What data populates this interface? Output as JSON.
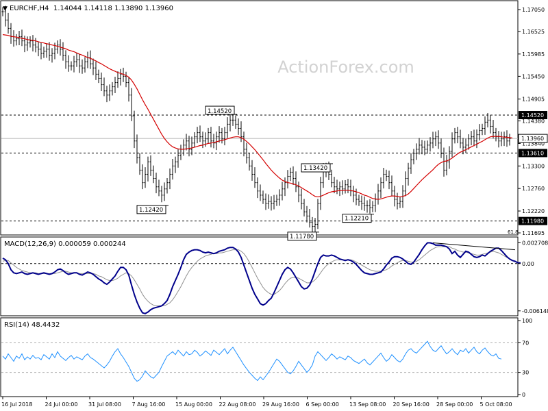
{
  "chart_data": {
    "type": "line",
    "symbol": "EURCHF,H4",
    "ohlc_text": "1.14044 1.14118 1.13890 1.13960",
    "watermark": "ActionForex.com",
    "x_tick_labels": [
      "16 Jul 2018",
      "24 Jul 00:00",
      "31 Jul 08:00",
      "7 Aug 16:00",
      "15 Aug 00:00",
      "22 Aug 08:00",
      "29 Aug 16:00",
      "6 Sep 00:00",
      "13 Sep 08:00",
      "20 Sep 16:00",
      "28 Sep 00:00",
      "5 Oct 08:00"
    ],
    "price_panel": {
      "ylim": [
        1.11695,
        1.1705
      ],
      "y_tick_labels": [
        "1.17050",
        "1.16525",
        "1.15985",
        "1.15450",
        "1.14905",
        "1.14380",
        "1.13840",
        "1.13300",
        "1.12760",
        "1.12220",
        "1.11695"
      ],
      "current_price": "1.13960",
      "levels": [
        {
          "value": 1.1452,
          "label": "1.14520",
          "style": "dashed"
        },
        {
          "value": 1.1361,
          "label": "1.13610",
          "style": "dashed"
        },
        {
          "value": 1.1198,
          "label": "1.11980",
          "style": "dashed"
        }
      ],
      "annotations": [
        {
          "label": "1.14520",
          "bar": 85
        },
        {
          "label": "1.12420",
          "bar": 60
        },
        {
          "label": "1.11780",
          "bar": 115
        },
        {
          "label": "1.13420",
          "bar": 120
        },
        {
          "label": "1.12210",
          "bar": 135
        }
      ],
      "partial_label": "61.8",
      "close": [
        1.17,
        1.168,
        1.166,
        1.164,
        1.163,
        1.1635,
        1.164,
        1.163,
        1.162,
        1.1625,
        1.163,
        1.162,
        1.1615,
        1.161,
        1.16,
        1.1605,
        1.161,
        1.1595,
        1.16,
        1.161,
        1.162,
        1.161,
        1.1595,
        1.158,
        1.157,
        1.157,
        1.158,
        1.1585,
        1.157,
        1.1565,
        1.158,
        1.159,
        1.1575,
        1.1565,
        1.155,
        1.154,
        1.1525,
        1.151,
        1.15,
        1.151,
        1.152,
        1.153,
        1.154,
        1.155,
        1.1545,
        1.153,
        1.15,
        1.145,
        1.139,
        1.135,
        1.132,
        1.129,
        1.131,
        1.134,
        1.132,
        1.13,
        1.128,
        1.127,
        1.126,
        1.1275,
        1.129,
        1.131,
        1.133,
        1.134,
        1.1355,
        1.137,
        1.138,
        1.139,
        1.137,
        1.1385,
        1.14,
        1.141,
        1.14,
        1.139,
        1.1395,
        1.141,
        1.139,
        1.1385,
        1.14,
        1.141,
        1.1395,
        1.141,
        1.143,
        1.144,
        1.144,
        1.143,
        1.142,
        1.14,
        1.137,
        1.135,
        1.133,
        1.131,
        1.129,
        1.127,
        1.126,
        1.125,
        1.124,
        1.1245,
        1.124,
        1.1245,
        1.125,
        1.126,
        1.1275,
        1.129,
        1.1305,
        1.1315,
        1.13,
        1.128,
        1.126,
        1.124,
        1.122,
        1.121,
        1.1195,
        1.1185,
        1.119,
        1.124,
        1.129,
        1.132,
        1.1325,
        1.131,
        1.129,
        1.128,
        1.1275,
        1.128,
        1.1275,
        1.1285,
        1.128,
        1.127,
        1.126,
        1.125,
        1.1245,
        1.124,
        1.1235,
        1.1235,
        1.123,
        1.1235,
        1.125,
        1.127,
        1.129,
        1.131,
        1.1305,
        1.129,
        1.127,
        1.125,
        1.124,
        1.1245,
        1.127,
        1.13,
        1.1325,
        1.1345,
        1.136,
        1.137,
        1.138,
        1.1375,
        1.137,
        1.138,
        1.1385,
        1.1395,
        1.14,
        1.1385,
        1.136,
        1.132,
        1.134,
        1.1365,
        1.1395,
        1.141,
        1.14,
        1.1385,
        1.1375,
        1.138,
        1.1395,
        1.14,
        1.139,
        1.1405,
        1.1415,
        1.142,
        1.1435,
        1.144,
        1.1425,
        1.141,
        1.14,
        1.139,
        1.1395,
        1.14,
        1.139,
        1.1396
      ],
      "ma_line": [
        1.1645,
        1.1644,
        1.1643,
        1.1641,
        1.164,
        1.1639,
        1.1638,
        1.1636,
        1.1635,
        1.1633,
        1.1632,
        1.1631,
        1.163,
        1.1628,
        1.1626,
        1.1625,
        1.1623,
        1.1622,
        1.162,
        1.1619,
        1.1617,
        1.1615,
        1.1613,
        1.1611,
        1.1608,
        1.1606,
        1.1604,
        1.1601,
        1.1598,
        1.1596,
        1.1593,
        1.159,
        1.1588,
        1.1585,
        1.1582,
        1.1578,
        1.1575,
        1.1571,
        1.1567,
        1.1563,
        1.156,
        1.1557,
        1.1554,
        1.1552,
        1.155,
        1.1547,
        1.1543,
        1.1536,
        1.1526,
        1.1515,
        1.1502,
        1.1489,
        1.1477,
        1.1466,
        1.1454,
        1.1442,
        1.143,
        1.1418,
        1.1406,
        1.1396,
        1.1388,
        1.1381,
        1.1376,
        1.1373,
        1.1371,
        1.137,
        1.137,
        1.1371,
        1.1372,
        1.1373,
        1.1375,
        1.1377,
        1.1379,
        1.138,
        1.1382,
        1.1384,
        1.1385,
        1.1386,
        1.1388,
        1.139,
        1.1391,
        1.1393,
        1.1395,
        1.1397,
        1.1399,
        1.14,
        1.14,
        1.1398,
        1.1394,
        1.1389,
        1.1383,
        1.1376,
        1.1369,
        1.1361,
        1.1353,
        1.1345,
        1.1336,
        1.1328,
        1.132,
        1.1313,
        1.1307,
        1.1301,
        1.1296,
        1.1293,
        1.129,
        1.1289,
        1.1287,
        1.1285,
        1.1282,
        1.1278,
        1.1274,
        1.127,
        1.1266,
        1.1261,
        1.1257,
        1.1256,
        1.1257,
        1.126,
        1.1263,
        1.1266,
        1.1268,
        1.1269,
        1.127,
        1.1271,
        1.1271,
        1.1272,
        1.1272,
        1.1271,
        1.127,
        1.1268,
        1.1266,
        1.1263,
        1.126,
        1.1258,
        1.1255,
        1.1252,
        1.1251,
        1.125,
        1.1251,
        1.1253,
        1.1255,
        1.1257,
        1.1258,
        1.1258,
        1.1257,
        1.1256,
        1.1257,
        1.1259,
        1.1263,
        1.1269,
        1.1276,
        1.1283,
        1.129,
        1.1297,
        1.1303,
        1.1309,
        1.1315,
        1.1321,
        1.1328,
        1.1334,
        1.1338,
        1.1341,
        1.1342,
        1.1345,
        1.1349,
        1.1354,
        1.1359,
        1.1363,
        1.1366,
        1.1369,
        1.1372,
        1.1376,
        1.1379,
        1.1382,
        1.1386,
        1.1389,
        1.1393,
        1.1397,
        1.14,
        1.1401,
        1.1401,
        1.1401,
        1.14,
        1.1399,
        1.1399,
        1.1398,
        1.1397
      ]
    },
    "macd_panel": {
      "title": "MACD(12,26,9) 0.000059 0.000244",
      "y_tick_labels": [
        "0.002708",
        "0.00",
        "-0.006148"
      ],
      "ylim": [
        -0.0067,
        0.0031
      ],
      "macd_line": [
        0.0007,
        0.0005,
        0.0,
        -0.0008,
        -0.0012,
        -0.0013,
        -0.0012,
        -0.0011,
        -0.0013,
        -0.0014,
        -0.0013,
        -0.0012,
        -0.0013,
        -0.0014,
        -0.0013,
        -0.0012,
        -0.0013,
        -0.0014,
        -0.0013,
        -0.0011,
        -0.0008,
        -0.0007,
        -0.0009,
        -0.0012,
        -0.0014,
        -0.0013,
        -0.0012,
        -0.0012,
        -0.0014,
        -0.0015,
        -0.0013,
        -0.0011,
        -0.0012,
        -0.0014,
        -0.0017,
        -0.002,
        -0.0022,
        -0.0025,
        -0.0027,
        -0.0024,
        -0.002,
        -0.0016,
        -0.001,
        -0.0005,
        -0.0005,
        -0.0008,
        -0.0015,
        -0.0028,
        -0.004,
        -0.005,
        -0.0058,
        -0.0064,
        -0.0065,
        -0.0063,
        -0.006,
        -0.0058,
        -0.0057,
        -0.0056,
        -0.0055,
        -0.0052,
        -0.0048,
        -0.004,
        -0.003,
        -0.0022,
        -0.0014,
        -0.0005,
        0.0005,
        0.0012,
        0.0015,
        0.0017,
        0.0018,
        0.0018,
        0.0017,
        0.0015,
        0.0014,
        0.0015,
        0.0014,
        0.0013,
        0.0014,
        0.0016,
        0.0017,
        0.0018,
        0.002,
        0.0021,
        0.0021,
        0.0019,
        0.0015,
        0.0008,
        -0.0002,
        -0.0012,
        -0.0022,
        -0.0032,
        -0.004,
        -0.0046,
        -0.0052,
        -0.0054,
        -0.0052,
        -0.0048,
        -0.0045,
        -0.0038,
        -0.003,
        -0.0022,
        -0.0014,
        -0.0008,
        -0.0005,
        -0.0007,
        -0.0012,
        -0.0018,
        -0.0024,
        -0.003,
        -0.0033,
        -0.0032,
        -0.0028,
        -0.002,
        -0.001,
        0.0,
        0.0008,
        0.0011,
        0.001,
        0.001,
        0.0011,
        0.001,
        0.0008,
        0.0006,
        0.0005,
        0.0004,
        0.0005,
        0.0004,
        0.0002,
        -0.0001,
        -0.0005,
        -0.0009,
        -0.0012,
        -0.0013,
        -0.0014,
        -0.0014,
        -0.0013,
        -0.0012,
        -0.0011,
        -0.0007,
        -0.0002,
        0.0002,
        0.0007,
        0.0009,
        0.0009,
        0.0008,
        0.0006,
        0.0003,
        0.0,
        -0.0001,
        0.0002,
        0.0007,
        0.0012,
        0.0018,
        0.0023,
        0.0027,
        0.0027,
        0.0026,
        0.0024,
        0.0024,
        0.0024,
        0.0023,
        0.0022,
        0.0019,
        0.0013,
        0.0016,
        0.0011,
        0.0008,
        0.0012,
        0.0016,
        0.0015,
        0.0012,
        0.0009,
        0.0008,
        0.0009,
        0.0011,
        0.001,
        0.0013,
        0.0016,
        0.0018,
        0.002,
        0.002,
        0.0017,
        0.0013,
        0.0009,
        0.0006,
        0.0004,
        0.0003,
        0.0001,
        0.0001
      ],
      "signal_line": [
        0.0003,
        0.0004,
        0.0004,
        0.0001,
        -0.0002,
        -0.0005,
        -0.0007,
        -0.0009,
        -0.001,
        -0.0011,
        -0.0012,
        -0.0012,
        -0.0012,
        -0.0013,
        -0.0013,
        -0.0013,
        -0.0013,
        -0.0013,
        -0.0013,
        -0.0013,
        -0.0012,
        -0.0011,
        -0.001,
        -0.001,
        -0.0011,
        -0.0012,
        -0.0012,
        -0.0012,
        -0.0013,
        -0.0013,
        -0.0013,
        -0.0013,
        -0.0013,
        -0.0013,
        -0.0014,
        -0.0016,
        -0.0017,
        -0.0019,
        -0.0021,
        -0.0022,
        -0.0022,
        -0.0021,
        -0.0019,
        -0.0016,
        -0.0014,
        -0.0012,
        -0.0013,
        -0.0016,
        -0.0021,
        -0.0027,
        -0.0033,
        -0.004,
        -0.0045,
        -0.0049,
        -0.0052,
        -0.0054,
        -0.0055,
        -0.0055,
        -0.0055,
        -0.0055,
        -0.0053,
        -0.0051,
        -0.0047,
        -0.0042,
        -0.0036,
        -0.003,
        -0.0023,
        -0.0016,
        -0.001,
        -0.0005,
        -0.0001,
        0.0003,
        0.0006,
        0.0008,
        0.001,
        0.0011,
        0.0012,
        0.0013,
        0.0013,
        0.0014,
        0.0014,
        0.0015,
        0.0016,
        0.0017,
        0.0018,
        0.0018,
        0.0018,
        0.0016,
        0.0013,
        0.0008,
        0.0002,
        -0.0005,
        -0.0012,
        -0.0019,
        -0.0025,
        -0.0031,
        -0.0035,
        -0.0038,
        -0.004,
        -0.004,
        -0.0038,
        -0.0035,
        -0.0031,
        -0.0026,
        -0.0022,
        -0.0019,
        -0.0018,
        -0.0018,
        -0.0019,
        -0.0021,
        -0.0023,
        -0.0025,
        -0.0025,
        -0.0024,
        -0.0021,
        -0.0017,
        -0.0012,
        -0.0007,
        -0.0003,
        0.0,
        0.0002,
        0.0004,
        0.0005,
        0.0005,
        0.0005,
        0.0005,
        0.0005,
        0.0005,
        0.0004,
        0.0002,
        0.0,
        -0.0002,
        -0.0004,
        -0.0006,
        -0.0008,
        -0.0009,
        -0.001,
        -0.001,
        -0.001,
        -0.0009,
        -0.0008,
        -0.0006,
        -0.0003,
        -0.0001,
        0.0001,
        0.0003,
        0.0004,
        0.0004,
        0.0003,
        0.0002,
        0.0002,
        0.0003,
        0.0005,
        0.0008,
        0.0011,
        0.0014,
        0.0017,
        0.0019,
        0.0021,
        0.0022,
        0.0022,
        0.0022,
        0.0022,
        0.0022,
        0.002,
        0.0019,
        0.0017,
        0.0016,
        0.0015,
        0.0015,
        0.0014,
        0.0013,
        0.0012,
        0.0011,
        0.0011,
        0.0012,
        0.0013,
        0.0014,
        0.0015,
        0.0016,
        0.0015,
        0.0014,
        0.0012,
        0.001,
        0.0008,
        0.0006,
        0.0004,
        0.0002
      ],
      "trendline": [
        [
          157,
          0.0027
        ],
        [
          184,
          0.0018
        ]
      ]
    },
    "rsi_panel": {
      "title": "RSI(14) 48.4432",
      "y_tick_labels": [
        "100",
        "70",
        "30",
        "0"
      ],
      "ylim": [
        0,
        100
      ],
      "levels": [
        70,
        30
      ],
      "rsi_line": [
        52,
        48,
        55,
        50,
        45,
        52,
        49,
        55,
        47,
        51,
        48,
        53,
        49,
        50,
        47,
        54,
        51,
        48,
        55,
        50,
        58,
        52,
        49,
        46,
        50,
        53,
        48,
        51,
        49,
        47,
        52,
        55,
        50,
        48,
        45,
        42,
        39,
        36,
        40,
        45,
        52,
        58,
        62,
        55,
        50,
        44,
        38,
        30,
        22,
        18,
        20,
        25,
        32,
        28,
        24,
        22,
        26,
        30,
        38,
        45,
        52,
        55,
        58,
        54,
        60,
        56,
        52,
        58,
        54,
        55,
        60,
        57,
        52,
        55,
        59,
        56,
        53,
        60,
        57,
        54,
        58,
        62,
        55,
        60,
        64,
        58,
        52,
        46,
        40,
        35,
        30,
        26,
        22,
        19,
        24,
        20,
        25,
        30,
        36,
        42,
        48,
        45,
        40,
        35,
        30,
        28,
        32,
        38,
        45,
        40,
        35,
        30,
        34,
        40,
        52,
        58,
        54,
        50,
        46,
        50,
        55,
        52,
        48,
        51,
        49,
        47,
        52,
        50,
        46,
        44,
        42,
        45,
        48,
        43,
        40,
        44,
        48,
        52,
        56,
        50,
        45,
        48,
        54,
        50,
        46,
        44,
        48,
        55,
        60,
        62,
        58,
        56,
        60,
        64,
        68,
        72,
        65,
        60,
        58,
        62,
        66,
        60,
        55,
        58,
        62,
        57,
        54,
        60,
        58,
        62,
        56,
        60,
        64,
        58,
        55,
        60,
        63,
        58,
        54,
        52,
        55,
        49,
        48
      ]
    }
  }
}
